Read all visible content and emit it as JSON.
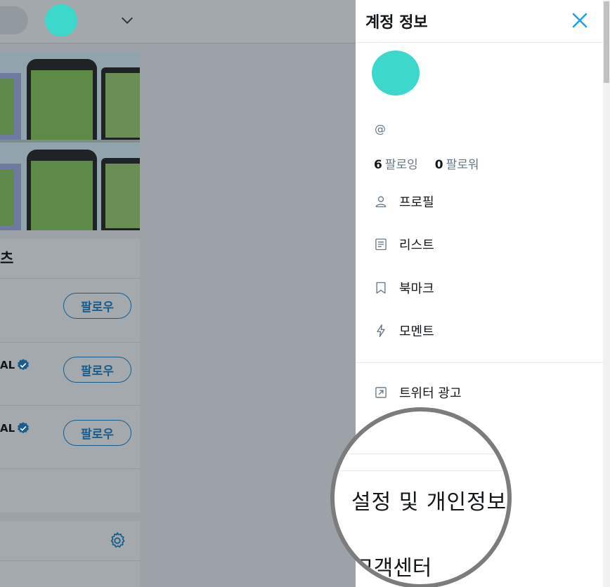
{
  "background": {
    "trends_title_fragment": "츠",
    "follow_buttons": [
      {
        "label": "팔로우",
        "name_fragment": "",
        "verified": false
      },
      {
        "label": "팔로우",
        "name_fragment": "AL",
        "verified": true
      },
      {
        "label": "팔로우",
        "name_fragment": "AL",
        "verified": true
      }
    ]
  },
  "drawer": {
    "title": "계정 정보",
    "handle": "@",
    "following_count": "6",
    "following_label": "팔로잉",
    "followers_count": "0",
    "followers_label": "팔로워",
    "menu": [
      {
        "label": "프로필",
        "icon": "person-icon"
      },
      {
        "label": "리스트",
        "icon": "list-icon"
      },
      {
        "label": "북마크",
        "icon": "bookmark-icon"
      },
      {
        "label": "모멘트",
        "icon": "lightning-icon"
      }
    ],
    "ads_label": "트위터 광고",
    "settings_label": "설정 및 개인정보",
    "help_label": "고객센터"
  },
  "colors": {
    "accent": "#1da1f2",
    "avatar": "#3cd8cc"
  }
}
